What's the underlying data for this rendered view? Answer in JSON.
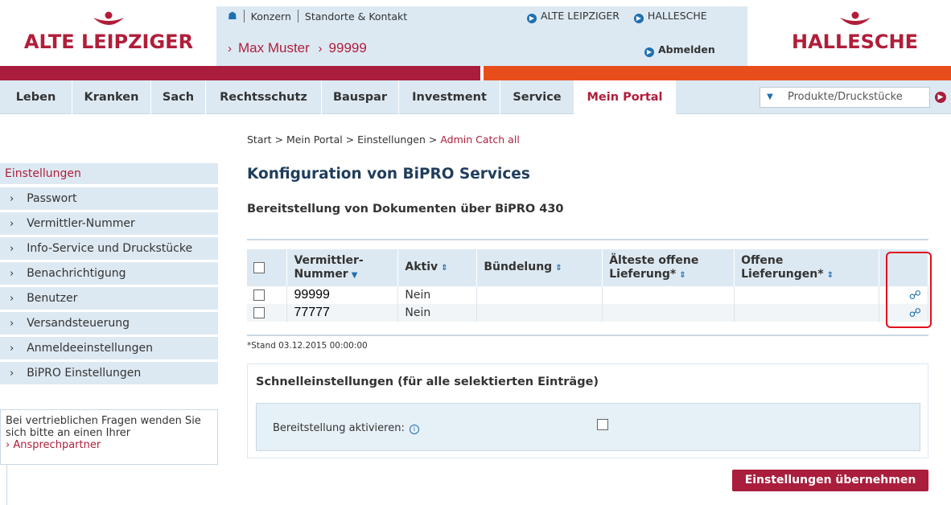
{
  "header": {
    "logo_left": "ALTE LEIPZIGER",
    "logo_right": "HALLESCHE",
    "top_links": [
      "Konzern",
      "Standorte & Kontakt"
    ],
    "brand_links": [
      "ALTE LEIPZIGER",
      "HALLESCHE"
    ],
    "user_name": "Max Muster",
    "user_number": "99999",
    "logout_label": "Abmelden"
  },
  "nav": {
    "items": [
      "Leben",
      "Kranken",
      "Sach",
      "Rechtsschutz",
      "Bauspar",
      "Investment",
      "Service",
      "Mein Portal"
    ],
    "active": "Mein Portal",
    "search_placeholder": "Produkte/Druckstücke"
  },
  "sidebar": {
    "heading": "Einstellungen",
    "items": [
      "Passwort",
      "Vermittler-Nummer",
      "Info-Service und Druckstücke",
      "Benachrichtigung",
      "Benutzer",
      "Versandsteuerung",
      "Anmeldeeinstellungen",
      "BiPRO Einstellungen"
    ],
    "info_text": "Bei vertrieblichen Fragen wenden Sie sich bitte an einen Ihrer",
    "info_link": "Ansprechpartner"
  },
  "breadcrumb": {
    "path": "Start > Mein Portal > Einstellungen >",
    "current": "Admin Catch all"
  },
  "main": {
    "title": "Konfiguration von BiPRO Services",
    "subtitle": "Bereitstellung von Dokumenten über BiPRO 430",
    "columns": {
      "vermittler": "Vermittler-\nNummer",
      "aktiv": "Aktiv",
      "buendelung": "Bündelung",
      "aelteste": "Älteste offene\nLieferung*",
      "offene": "Offene\nLieferungen*"
    },
    "rows": [
      {
        "nummer": "99999",
        "aktiv": "Nein",
        "buendelung": "",
        "aelteste": "",
        "offene": ""
      },
      {
        "nummer": "77777",
        "aktiv": "Nein",
        "buendelung": "",
        "aelteste": "",
        "offene": ""
      }
    ],
    "stand": "*Stand 03.12.2015 00:00:00",
    "quick_title": "Schnelleinstellungen (für alle selektierten Einträge)",
    "quick_label": "Bereitstellung aktivieren:",
    "apply_label": "Einstellungen übernehmen"
  },
  "colors": {
    "brand_red": "#aa1d3c",
    "brand_orange": "#e84e1b",
    "light_blue": "#dde9f2",
    "link_blue": "#1e6fb0",
    "highlight": "#e0101e"
  }
}
